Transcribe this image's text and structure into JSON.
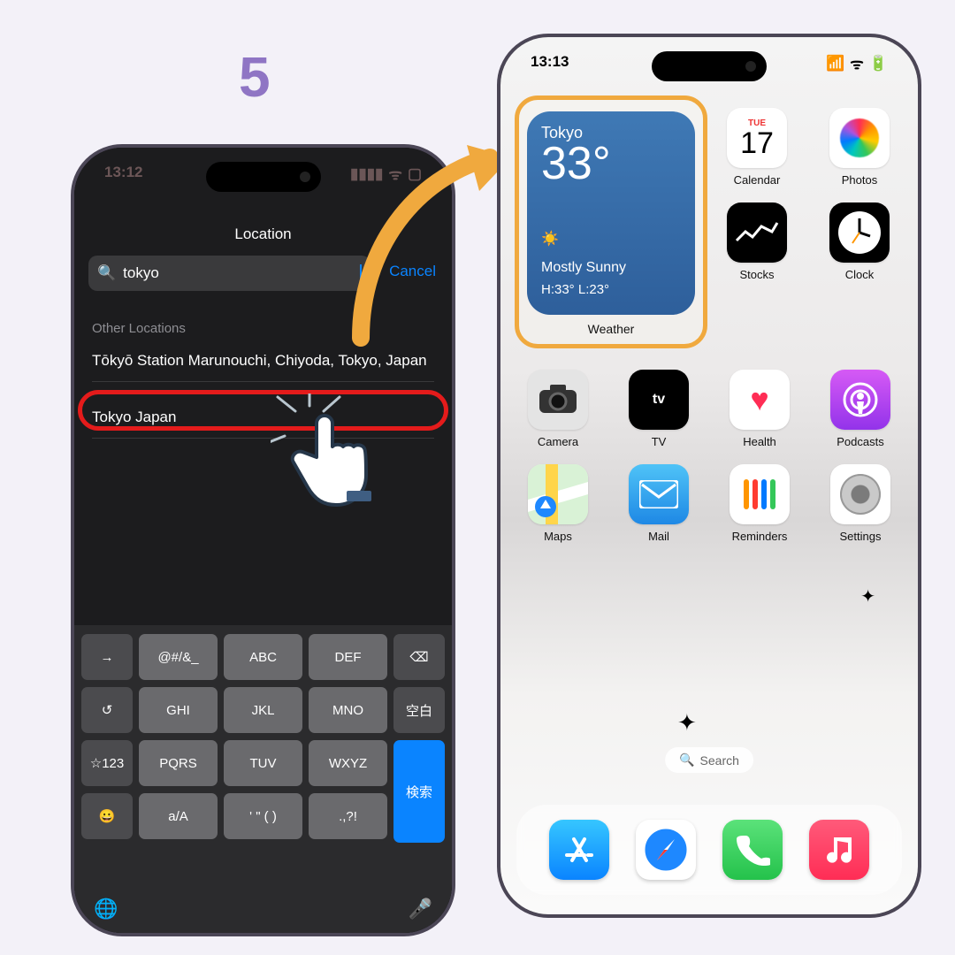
{
  "step_number": "5",
  "left_phone": {
    "status_time": "13:12",
    "sheet_title": "Location",
    "search_query": "tokyo",
    "cancel": "Cancel",
    "section_header": "Other Locations",
    "results": [
      "Tōkyō Station Marunouchi, Chiyoda, Tokyo, Japan",
      "Tokyo Japan"
    ],
    "keyboard": {
      "rows": [
        [
          "→",
          "@#/&_",
          "ABC",
          "DEF",
          "⌫"
        ],
        [
          "↺",
          "GHI",
          "JKL",
          "MNO",
          "空白"
        ],
        [
          "☆123",
          "PQRS",
          "TUV",
          "WXYZ",
          "検索"
        ],
        [
          "😀",
          "a/A",
          "' \" ( )",
          ".,?!",
          ""
        ]
      ],
      "globe": "🌐",
      "mic": "🎤"
    }
  },
  "right_phone": {
    "status_time": "13:13",
    "widget": {
      "city": "Tokyo",
      "temp": "33°",
      "condition": "Mostly Sunny",
      "high_low": "H:33° L:23°",
      "label": "Weather"
    },
    "apps_row1": [
      {
        "label": "Calendar",
        "day": "TUE",
        "date": "17"
      },
      {
        "label": "Photos"
      }
    ],
    "apps_row2": [
      {
        "label": "Stocks"
      },
      {
        "label": "Clock"
      }
    ],
    "apps_row3": [
      {
        "label": "Camera"
      },
      {
        "label": "TV"
      },
      {
        "label": "Health"
      },
      {
        "label": "Podcasts"
      }
    ],
    "apps_row4": [
      {
        "label": "Maps"
      },
      {
        "label": "Mail"
      },
      {
        "label": "Reminders"
      },
      {
        "label": "Settings"
      }
    ],
    "search_label": "Search",
    "dock": [
      "App Store",
      "Safari",
      "Phone",
      "Music"
    ]
  }
}
